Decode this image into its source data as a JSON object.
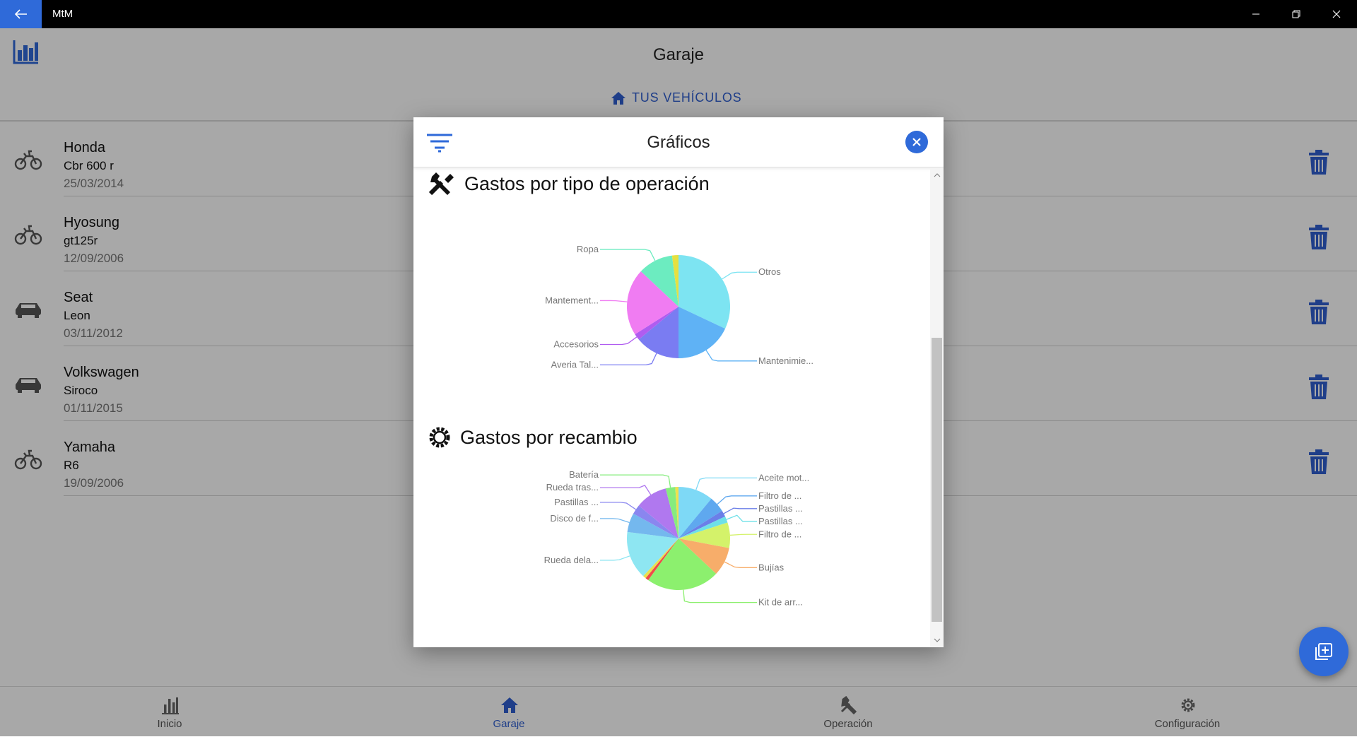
{
  "window": {
    "title": "MtM"
  },
  "header": {
    "title": "Garaje",
    "tab_label": "TUS VEHÍCULOS"
  },
  "vehicles": [
    {
      "make": "Honda",
      "model": "Cbr 600 r",
      "date": "25/03/2014",
      "type": "motorcycle"
    },
    {
      "make": "Hyosung",
      "model": "gt125r",
      "date": "12/09/2006",
      "type": "motorcycle"
    },
    {
      "make": "Seat",
      "model": "Leon",
      "date": "03/11/2012",
      "type": "car"
    },
    {
      "make": "Volkswagen",
      "model": "Siroco",
      "date": "01/11/2015",
      "type": "car"
    },
    {
      "make": "Yamaha",
      "model": "R6",
      "date": "19/09/2006",
      "type": "motorcycle"
    }
  ],
  "nav": [
    {
      "label": "Inicio",
      "icon": "bar-chart-icon"
    },
    {
      "label": "Garaje",
      "icon": "home-icon",
      "active": true
    },
    {
      "label": "Operación",
      "icon": "tools-icon"
    },
    {
      "label": "Configuración",
      "icon": "gear-icon"
    }
  ],
  "modal": {
    "title": "Gráficos",
    "sections": [
      {
        "title": "Gastos por tipo de operación",
        "icon": "tools-icon"
      },
      {
        "title": "Gastos por recambio",
        "icon": "gear-icon"
      }
    ]
  },
  "colors": {
    "accent": "#2f6ad9",
    "titlebar": "#000000",
    "overlay": "rgba(0,0,0,0.34)"
  },
  "chart_data": [
    {
      "type": "pie",
      "title": "Gastos por tipo de operación",
      "categories": [
        "Otros",
        "Mantenimie...",
        "Averia Tal...",
        "Accesorios",
        "Mantement...",
        "Ropa",
        ""
      ],
      "values": [
        32,
        18,
        14,
        2,
        21,
        11,
        2
      ],
      "colors": [
        "#7de4f2",
        "#5fb2f5",
        "#7a7cf2",
        "#b05cf0",
        "#f07cf2",
        "#6cecc0",
        "#e6e040"
      ]
    },
    {
      "type": "pie",
      "title": "Gastos por recambio",
      "categories": [
        "Aceite mot...",
        "Filtro de ...",
        "Pastillas ...",
        "Pastillas ...",
        "Filtro de ...",
        "Bujías",
        "Kit de arr...",
        "",
        "",
        "Rueda dela...",
        "Disco de f...",
        "Pastillas ...",
        "Rueda tras...",
        "Batería",
        ""
      ],
      "values": [
        11,
        5,
        2,
        2,
        8,
        9,
        23,
        1,
        1,
        15,
        6,
        3,
        10,
        3,
        1
      ],
      "colors": [
        "#7ed9f6",
        "#5fa8ef",
        "#6b7fe8",
        "#6ee0e8",
        "#d4f26a",
        "#f7ad6a",
        "#8cf06e",
        "#f04a4a",
        "#e8e050",
        "#8ee6f2",
        "#74b8ee",
        "#8a86ef",
        "#b078ef",
        "#86ec7e",
        "#f0e04c"
      ]
    }
  ]
}
